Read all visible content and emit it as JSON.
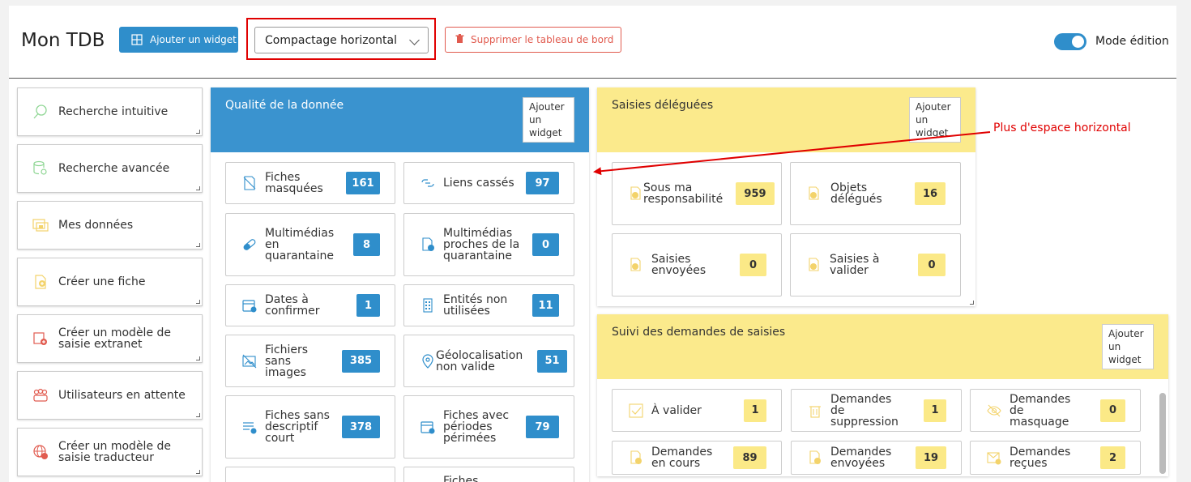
{
  "header": {
    "title": "Mon TDB",
    "add_widget_label": "Ajouter un widget",
    "compaction_value": "Compactage horizontal",
    "delete_label": "Supprimer le tableau de bord",
    "edit_mode_label": "Mode édition"
  },
  "sidebar": {
    "items": [
      {
        "label": "Recherche intuitive"
      },
      {
        "label": "Recherche avancée"
      },
      {
        "label": "Mes données"
      },
      {
        "label": "Créer une fiche"
      },
      {
        "label": "Créer un modèle de saisie extranet"
      },
      {
        "label": "Utilisateurs en attente"
      },
      {
        "label": "Créer un modèle de saisie traducteur"
      }
    ]
  },
  "quality_panel": {
    "title": "Qualité de la donnée",
    "add_label": "Ajouter un widget",
    "cards": [
      {
        "label": "Fiches masquées",
        "value": "161"
      },
      {
        "label": "Liens cassés",
        "value": "97"
      },
      {
        "label": "Multimédias en quarantaine",
        "value": "8"
      },
      {
        "label": "Multimédias proches de la quarantaine",
        "value": "0"
      },
      {
        "label": "Dates à confirmer",
        "value": "1"
      },
      {
        "label": "Entités non utilisées",
        "value": "11"
      },
      {
        "label": "Fichiers sans images",
        "value": "385"
      },
      {
        "label": "Géolocalisation non valide",
        "value": "51"
      },
      {
        "label": "Fiches sans descriptif court",
        "value": "378"
      },
      {
        "label": "Fiches avec périodes périmées",
        "value": "79"
      },
      {
        "label": "",
        "value": ""
      },
      {
        "label": "Fiches",
        "value": ""
      }
    ]
  },
  "delegated_panel": {
    "title": "Saisies déléguées",
    "add_label": "Ajouter un widget",
    "cards": [
      {
        "label": "Sous ma responsabilité",
        "value": "959"
      },
      {
        "label": "Objets délégués",
        "value": "16"
      },
      {
        "label": "Saisies envoyées",
        "value": "0"
      },
      {
        "label": "Saisies à valider",
        "value": "0"
      }
    ]
  },
  "requests_panel": {
    "title": "Suivi des demandes de saisies",
    "add_label": "Ajouter un widget",
    "cards": [
      {
        "label": "À valider",
        "value": "1"
      },
      {
        "label": "Demandes de suppression",
        "value": "1"
      },
      {
        "label": "Demandes de masquage",
        "value": "0"
      },
      {
        "label": "Demandes en cours",
        "value": "89"
      },
      {
        "label": "Demandes envoyées",
        "value": "19"
      },
      {
        "label": "Demandes reçues",
        "value": "2"
      }
    ]
  },
  "annotation": {
    "text": "Plus d'espace horizontal"
  },
  "colors": {
    "accent": "#2f8ecb",
    "yellow": "#fbe987",
    "danger": "#e15b4f",
    "annotation": "#e00000"
  }
}
